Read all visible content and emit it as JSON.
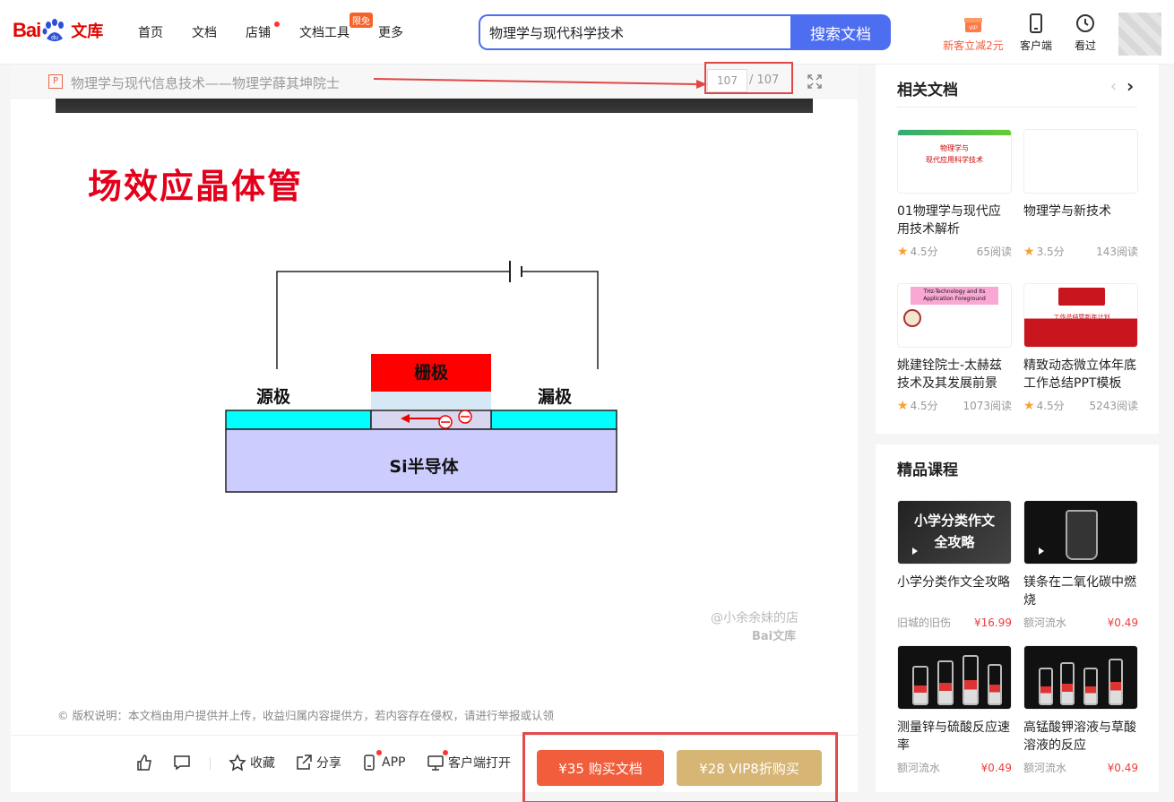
{
  "header": {
    "logo_text_left": "Bai",
    "logo_text_right": "文库",
    "nav": [
      "首页",
      "文档",
      "店铺",
      "文档工具",
      "更多"
    ],
    "limit_badge": "限免",
    "search_value": "物理学与现代科学技术",
    "search_button": "搜索文档",
    "vip_badge": "VIP",
    "promo": "新客立减2元",
    "client": "客户端",
    "history": "看过"
  },
  "doc": {
    "type_icon": "P",
    "title": "物理学与现代信息技术——物理学薛其坤院士",
    "page_current": "107",
    "page_total": "/ 107",
    "slide": {
      "title": "场效应晶体管",
      "source_label": "源极",
      "drain_label": "漏极",
      "gate_label": "栅极",
      "substrate_label": "Si半导体"
    },
    "watermark_user": "@小余余妹的店",
    "watermark_logo": "Bai文库",
    "copyright": "版权说明：本文档由用户提供并上传，收益归属内容提供方，若内容存在侵权，请进行举报或认领",
    "actions": {
      "favorite": "收藏",
      "share": "分享",
      "app": "APP",
      "client_open": "客户端打开"
    },
    "buy_button": "¥35 购买文档",
    "vip_buy_button": "¥28 VIP8折购买"
  },
  "related": {
    "title": "相关文档",
    "items": [
      {
        "title": "01物理学与现代应用技术解析",
        "rating": "4.5分",
        "reads": "65阅读",
        "thumb_text": "物理学与\n现代应用科学技术"
      },
      {
        "title": "物理学与新技术",
        "rating": "3.5分",
        "reads": "143阅读",
        "thumb_text": ""
      },
      {
        "title": "姚建铨院士-太赫兹技术及其发展前景",
        "rating": "4.5分",
        "reads": "1073阅读",
        "thumb_text": "THz-Technology and Its Application Foreground"
      },
      {
        "title": "精致动态微立体年底工作总结PPT模板",
        "rating": "4.5分",
        "reads": "5243阅读",
        "thumb_text": "工作总结暨新年计划"
      }
    ]
  },
  "courses": {
    "title": "精品课程",
    "items": [
      {
        "title": "小学分类作文全攻略",
        "author": "旧城的旧伤",
        "price": "¥16.99",
        "thumb_text": "小学分类作文\n全攻略"
      },
      {
        "title": "镁条在二氧化碳中燃烧",
        "author": "额河流水",
        "price": "¥0.49",
        "thumb_text": ""
      },
      {
        "title": "测量锌与硫酸反应速率",
        "author": "额河流水",
        "price": "¥0.49",
        "thumb_text": ""
      },
      {
        "title": "高锰酸钾溶液与草酸溶液的反应",
        "author": "额河流水",
        "price": "¥0.49",
        "thumb_text": ""
      }
    ]
  }
}
